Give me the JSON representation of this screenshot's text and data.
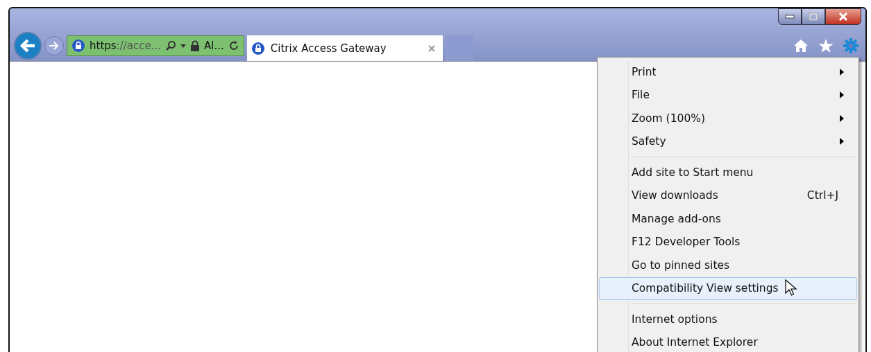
{
  "window": {
    "controls": [
      {
        "kind": "minimize"
      },
      {
        "kind": "maximize"
      },
      {
        "kind": "close"
      }
    ]
  },
  "address_bar": {
    "scheme": "https",
    "rest": "://acce...",
    "security": "Al..."
  },
  "tabs": [
    {
      "title": "Citrix Access Gateway",
      "selected": true
    }
  ],
  "menu": {
    "groups": [
      {
        "items": [
          {
            "label": "Print",
            "submenu": true,
            "selected": false
          },
          {
            "label": "File",
            "submenu": true,
            "selected": false
          },
          {
            "label": "Zoom (100%)",
            "submenu": true,
            "selected": false
          },
          {
            "label": "Safety",
            "submenu": true,
            "selected": false
          }
        ]
      },
      {
        "items": [
          {
            "label": "Add site to Start menu",
            "submenu": false,
            "selected": false
          },
          {
            "label": "View downloads",
            "shortcut": "Ctrl+J",
            "submenu": false,
            "selected": false
          },
          {
            "label": "Manage add-ons",
            "submenu": false,
            "selected": false
          },
          {
            "label": "F12 Developer Tools",
            "submenu": false,
            "selected": false
          },
          {
            "label": "Go to pinned sites",
            "submenu": false,
            "selected": false
          },
          {
            "label": "Compatibility View settings",
            "submenu": false,
            "selected": true
          }
        ]
      },
      {
        "items": [
          {
            "label": "Internet options",
            "submenu": false,
            "selected": false
          },
          {
            "label": "About Internet Explorer",
            "submenu": false,
            "selected": false
          }
        ]
      }
    ]
  }
}
